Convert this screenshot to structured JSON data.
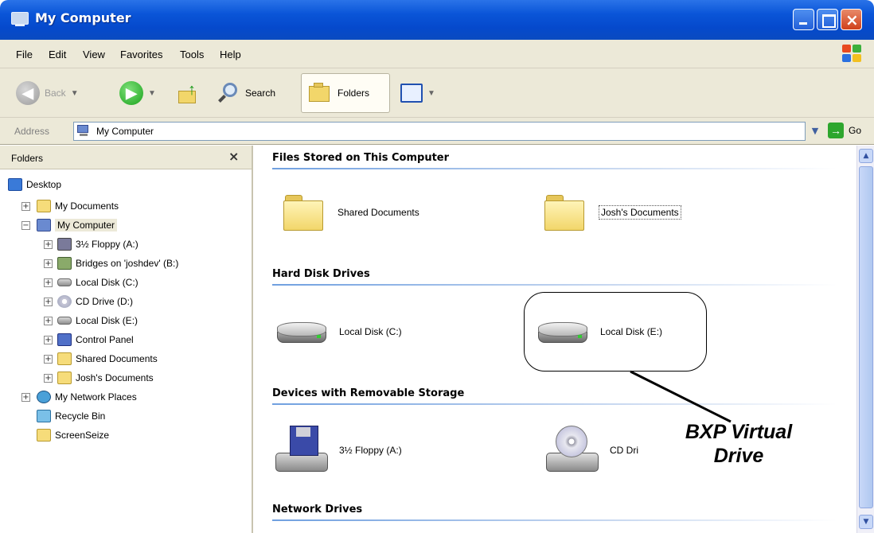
{
  "window": {
    "title": "My Computer",
    "menu": [
      "File",
      "Edit",
      "View",
      "Favorites",
      "Tools",
      "Help"
    ]
  },
  "toolbar": {
    "back_label": "Back",
    "search_label": "Search",
    "folders_label": "Folders"
  },
  "address": {
    "label": "Address",
    "value": "My Computer",
    "go_label": "Go"
  },
  "folders_pane": {
    "title": "Folders",
    "close_glyph": "×",
    "items": [
      {
        "label": "Desktop",
        "icon": "desktop-icon"
      },
      {
        "label": "My Documents",
        "icon": "my-documents-icon"
      },
      {
        "label": "My Computer",
        "icon": "my-computer-icon"
      },
      {
        "label": "3½ Floppy (A:)",
        "icon": "floppy-icon"
      },
      {
        "label": "Bridges on 'joshdev' (B:)",
        "icon": "network-drive-icon"
      },
      {
        "label": "Local Disk (C:)",
        "icon": "hard-disk-icon"
      },
      {
        "label": "CD Drive (D:)",
        "icon": "cd-drive-icon"
      },
      {
        "label": "Local Disk (E:)",
        "icon": "hard-disk-icon"
      },
      {
        "label": "Control Panel",
        "icon": "control-panel-icon"
      },
      {
        "label": "Shared Documents",
        "icon": "folder-icon"
      },
      {
        "label": "Josh's Documents",
        "icon": "folder-icon"
      },
      {
        "label": "My Network Places",
        "icon": "network-places-icon"
      },
      {
        "label": "Recycle Bin",
        "icon": "recycle-bin-icon"
      },
      {
        "label": "ScreenSeize",
        "icon": "folder-icon"
      }
    ]
  },
  "content": {
    "groups": [
      {
        "header": "Files Stored on This Computer",
        "items": [
          "Shared Documents",
          "Josh's Documents"
        ]
      },
      {
        "header": "Hard Disk Drives",
        "items": [
          "Local Disk (C:)",
          "Local Disk (E:)"
        ]
      },
      {
        "header": "Devices with Removable Storage",
        "items": [
          "3½ Floppy (A:)",
          "CD Dri"
        ]
      },
      {
        "header": "Network Drives",
        "items": []
      }
    ]
  },
  "annotation": {
    "line1": "BXP Virtual",
    "line2": "Drive"
  },
  "colors": {
    "titlebar": "#0a55d8",
    "chrome": "#ece9d8",
    "group_line": "#70a0e0"
  }
}
